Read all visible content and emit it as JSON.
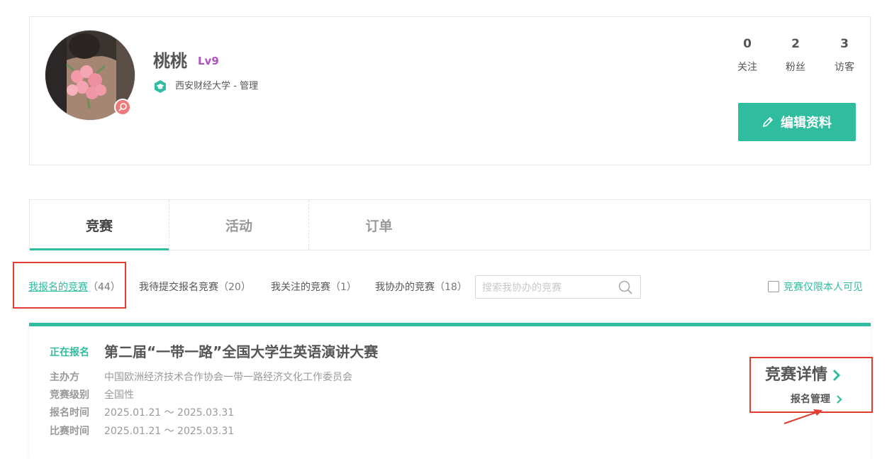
{
  "profile": {
    "username": "桃桃",
    "level_badge": "Lv9",
    "school": "西安财经大学 - 管理",
    "stats": [
      {
        "value": "0",
        "label": "关注"
      },
      {
        "value": "2",
        "label": "粉丝"
      },
      {
        "value": "3",
        "label": "访客"
      }
    ],
    "edit_button_label": "编辑资料"
  },
  "tabs": [
    {
      "label": "竞赛",
      "active": true
    },
    {
      "label": "活动",
      "active": false
    },
    {
      "label": "订单",
      "active": false
    }
  ],
  "filters": [
    {
      "label": "我报名的竞赛",
      "count": "（44）",
      "active": true
    },
    {
      "label": "我待提交报名竞赛",
      "count": "（20）",
      "active": false
    },
    {
      "label": "我关注的竞赛",
      "count": "（1）",
      "active": false
    },
    {
      "label": "我协办的竞赛",
      "count": "（18）",
      "active": false
    }
  ],
  "search": {
    "placeholder": "搜索我协办的竞赛",
    "value": ""
  },
  "visibility_checkbox": {
    "label": "竞赛仅限本人可见",
    "checked": false
  },
  "competition": {
    "status": "正在报名",
    "title": "第二届“一带一路”全国大学生英语演讲大赛",
    "meta": [
      {
        "label": "主办方",
        "value": "中国欧洲经济技术合作协会一带一路经济文化工作委员会"
      },
      {
        "label": "竞赛级别",
        "value": "全国性"
      },
      {
        "label": "报名时间",
        "value": "2025.01.21 ～ 2025.03.31"
      },
      {
        "label": "比赛时间",
        "value": "2025.01.21 ～ 2025.03.31"
      }
    ],
    "detail_link": "竞赛详情",
    "manage_link": "报名管理"
  },
  "colors": {
    "accent": "#2fbc9f",
    "annotation": "#e23b2f",
    "level": "#b14fc4"
  }
}
